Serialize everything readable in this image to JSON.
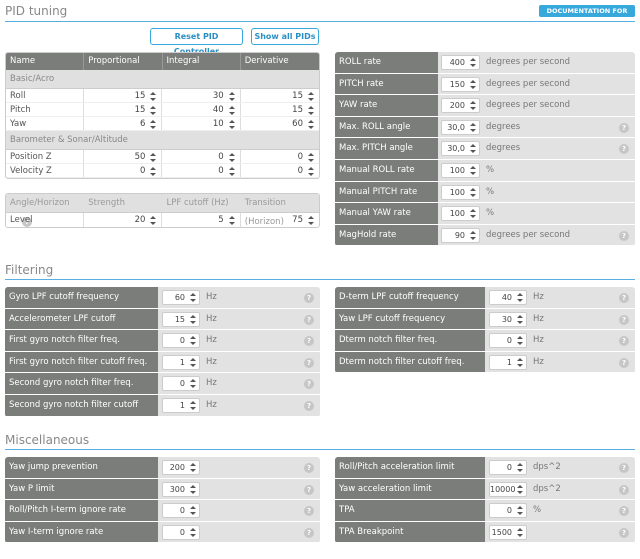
{
  "pid_section": {
    "title": "PID tuning",
    "doc_button": "DOCUMENTATION FOR INAV",
    "reset_button": "Reset PID Controller",
    "show_all_button": "Show all PIDs"
  },
  "pid_table": {
    "headers": [
      "Name",
      "Proportional",
      "Integral",
      "Derivative"
    ],
    "groups": [
      {
        "label": "Basic/Acro",
        "rows": [
          {
            "name": "Roll",
            "values": [
              "15",
              "30",
              "15"
            ]
          },
          {
            "name": "Pitch",
            "values": [
              "15",
              "40",
              "15"
            ]
          },
          {
            "name": "Yaw",
            "values": [
              "6",
              "10",
              "60"
            ]
          }
        ]
      },
      {
        "label": "Barometer & Sonar/Altitude",
        "rows": [
          {
            "name": "Position Z",
            "values": [
              "50",
              "0",
              "0"
            ]
          },
          {
            "name": "Velocity Z",
            "values": [
              "0",
              "0",
              "0"
            ]
          }
        ]
      }
    ]
  },
  "angle_table": {
    "headers": [
      "Angle/Horizon",
      "Strength",
      "LPF cutoff (Hz)",
      "Transition (Horizon)"
    ],
    "row": {
      "name": "Level",
      "values": [
        "20",
        "5",
        "75"
      ]
    }
  },
  "rates": [
    {
      "label": "ROLL rate",
      "value": "400",
      "unit": "degrees per second",
      "help": false
    },
    {
      "label": "PITCH rate",
      "value": "150",
      "unit": "degrees per second",
      "help": false
    },
    {
      "label": "YAW rate",
      "value": "200",
      "unit": "degrees per second",
      "help": false
    },
    {
      "label": "Max. ROLL angle",
      "value": "30,0",
      "unit": "degrees",
      "help": true
    },
    {
      "label": "Max. PITCH angle",
      "value": "30,0",
      "unit": "degrees",
      "help": true
    },
    {
      "label": "Manual ROLL rate",
      "value": "100",
      "unit": "%",
      "help": false
    },
    {
      "label": "Manual PITCH rate",
      "value": "100",
      "unit": "%",
      "help": false
    },
    {
      "label": "Manual YAW rate",
      "value": "100",
      "unit": "%",
      "help": false
    },
    {
      "label": "MagHold rate",
      "value": "90",
      "unit": "degrees per second",
      "help": true
    }
  ],
  "filtering": {
    "title": "Filtering",
    "left": [
      {
        "label": "Gyro LPF cutoff frequency",
        "value": "60",
        "unit": "Hz",
        "help": true
      },
      {
        "label": "Accelerometer LPF cutoff frequency",
        "value": "15",
        "unit": "Hz",
        "help": true
      },
      {
        "label": "First gyro notch filter freq.",
        "value": "0",
        "unit": "Hz",
        "help": true
      },
      {
        "label": "First gyro notch filter cutoff freq.",
        "value": "1",
        "unit": "Hz",
        "help": true
      },
      {
        "label": "Second gyro notch filter freq.",
        "value": "0",
        "unit": "Hz",
        "help": true
      },
      {
        "label": "Second gyro notch filter cutoff freq.",
        "value": "1",
        "unit": "Hz",
        "help": true
      }
    ],
    "right": [
      {
        "label": "D-term LPF cutoff frequency",
        "value": "40",
        "unit": "Hz",
        "help": true
      },
      {
        "label": "Yaw LPF cutoff frequency",
        "value": "30",
        "unit": "Hz",
        "help": true
      },
      {
        "label": "Dterm notch filter freq.",
        "value": "0",
        "unit": "Hz",
        "help": true
      },
      {
        "label": "Dterm notch filter cutoff freq.",
        "value": "1",
        "unit": "Hz",
        "help": true
      }
    ]
  },
  "misc": {
    "title": "Miscellaneous",
    "left": [
      {
        "label": "Yaw jump prevention",
        "value": "200",
        "unit": "",
        "help": true
      },
      {
        "label": "Yaw P limit",
        "value": "300",
        "unit": "",
        "help": true
      },
      {
        "label": "Roll/Pitch I-term ignore rate",
        "value": "0",
        "unit": "",
        "help": true
      },
      {
        "label": "Yaw I-term ignore rate",
        "value": "0",
        "unit": "",
        "help": true
      }
    ],
    "right": [
      {
        "label": "Roll/Pitch acceleration limit",
        "value": "0",
        "unit": "dps^2",
        "help": true
      },
      {
        "label": "Yaw acceleration limit",
        "value": "10000",
        "unit": "dps^2",
        "help": true
      },
      {
        "label": "TPA",
        "value": "0",
        "unit": "%",
        "help": true
      },
      {
        "label": "TPA Breakpoint",
        "value": "1500",
        "unit": "",
        "help": true
      }
    ]
  },
  "colors": {
    "accent": "#37a8db",
    "label_bg": "#7b7d7b",
    "panel_bg": "#e2e2e2"
  }
}
